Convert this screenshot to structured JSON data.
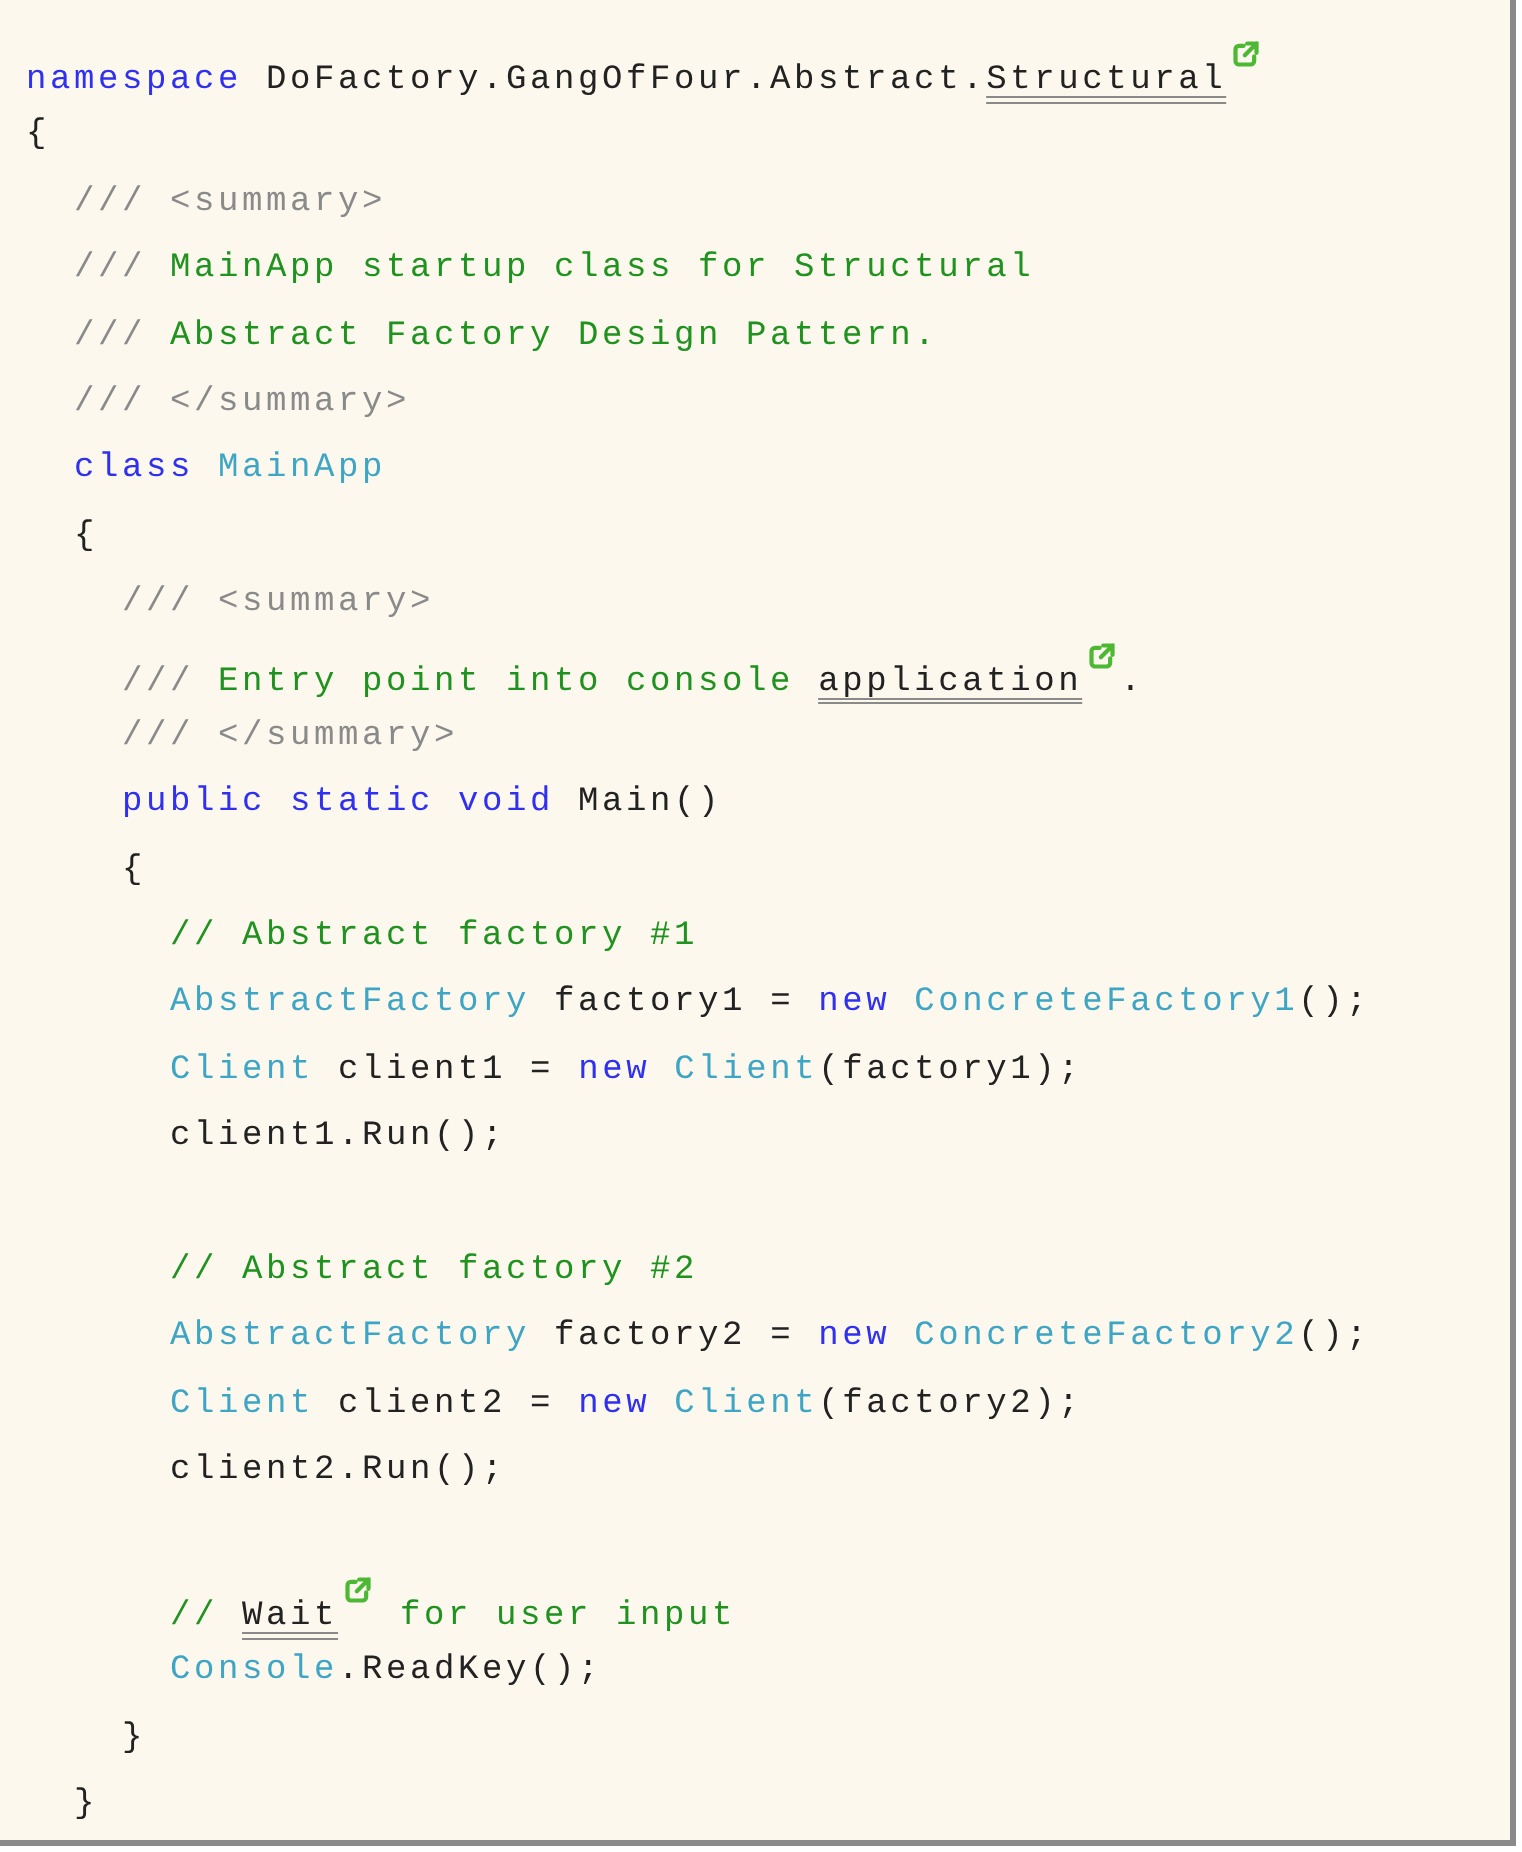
{
  "code_lines": [
    {
      "tokens": [
        {
          "kind": "keyword",
          "text": "namespace"
        },
        {
          "kind": "plain",
          "text": " DoFactory.GangOfFour.Abstract."
        },
        {
          "kind": "link",
          "text": "Structural"
        }
      ]
    },
    {
      "tokens": [
        {
          "kind": "plain",
          "text": "{"
        }
      ]
    },
    {
      "tokens": [
        {
          "kind": "doc",
          "text": "  /// <summary>"
        }
      ]
    },
    {
      "tokens": [
        {
          "kind": "doc",
          "text": "  /// "
        },
        {
          "kind": "comment",
          "text": "MainApp startup class for Structural"
        }
      ]
    },
    {
      "tokens": [
        {
          "kind": "doc",
          "text": "  /// "
        },
        {
          "kind": "comment",
          "text": "Abstract Factory Design Pattern."
        }
      ]
    },
    {
      "tokens": [
        {
          "kind": "doc",
          "text": "  /// </summary>"
        }
      ]
    },
    {
      "tokens": [
        {
          "kind": "keyword",
          "text": "  class"
        },
        {
          "kind": "type",
          "text": " MainApp"
        }
      ]
    },
    {
      "tokens": [
        {
          "kind": "plain",
          "text": "  {"
        }
      ]
    },
    {
      "tokens": [
        {
          "kind": "doc",
          "text": "    /// <summary>"
        }
      ]
    },
    {
      "tokens": [
        {
          "kind": "doc",
          "text": "    /// "
        },
        {
          "kind": "comment",
          "text": "Entry point into console "
        },
        {
          "kind": "link",
          "text": "application"
        },
        {
          "kind": "plain",
          "text": "."
        }
      ]
    },
    {
      "tokens": [
        {
          "kind": "doc",
          "text": "    /// </summary>"
        }
      ]
    },
    {
      "tokens": [
        {
          "kind": "keyword",
          "text": "    public static void"
        },
        {
          "kind": "plain",
          "text": " Main()"
        }
      ]
    },
    {
      "tokens": [
        {
          "kind": "plain",
          "text": "    {"
        }
      ]
    },
    {
      "tokens": [
        {
          "kind": "comment",
          "text": "      // Abstract factory #1"
        }
      ]
    },
    {
      "tokens": [
        {
          "kind": "type",
          "text": "      AbstractFactory"
        },
        {
          "kind": "plain",
          "text": " factory1 = "
        },
        {
          "kind": "keyword",
          "text": "new"
        },
        {
          "kind": "type",
          "text": " ConcreteFactory1"
        },
        {
          "kind": "plain",
          "text": "();"
        }
      ]
    },
    {
      "tokens": [
        {
          "kind": "type",
          "text": "      Client"
        },
        {
          "kind": "plain",
          "text": " client1 = "
        },
        {
          "kind": "keyword",
          "text": "new"
        },
        {
          "kind": "type",
          "text": " Client"
        },
        {
          "kind": "plain",
          "text": "(factory1);"
        }
      ]
    },
    {
      "gap_after": true,
      "tokens": [
        {
          "kind": "plain",
          "text": "      client1.Run();"
        }
      ]
    },
    {
      "tokens": [
        {
          "kind": "comment",
          "text": "      // Abstract factory #2"
        }
      ]
    },
    {
      "tokens": [
        {
          "kind": "type",
          "text": "      AbstractFactory"
        },
        {
          "kind": "plain",
          "text": " factory2 = "
        },
        {
          "kind": "keyword",
          "text": "new"
        },
        {
          "kind": "type",
          "text": " ConcreteFactory2"
        },
        {
          "kind": "plain",
          "text": "();"
        }
      ]
    },
    {
      "tokens": [
        {
          "kind": "type",
          "text": "      Client"
        },
        {
          "kind": "plain",
          "text": " client2 = "
        },
        {
          "kind": "keyword",
          "text": "new"
        },
        {
          "kind": "type",
          "text": " Client"
        },
        {
          "kind": "plain",
          "text": "(factory2);"
        }
      ]
    },
    {
      "gap_after": true,
      "tokens": [
        {
          "kind": "plain",
          "text": "      client2.Run();"
        }
      ]
    },
    {
      "tokens": [
        {
          "kind": "comment",
          "text": "      // "
        },
        {
          "kind": "link",
          "text": "Wait"
        },
        {
          "kind": "comment",
          "text": " for user input"
        }
      ]
    },
    {
      "tokens": [
        {
          "kind": "type",
          "text": "      Console"
        },
        {
          "kind": "plain",
          "text": ".ReadKey();"
        }
      ]
    },
    {
      "tokens": [
        {
          "kind": "plain",
          "text": "    }"
        }
      ]
    },
    {
      "tokens": [
        {
          "kind": "plain",
          "text": "  }"
        }
      ]
    }
  ]
}
